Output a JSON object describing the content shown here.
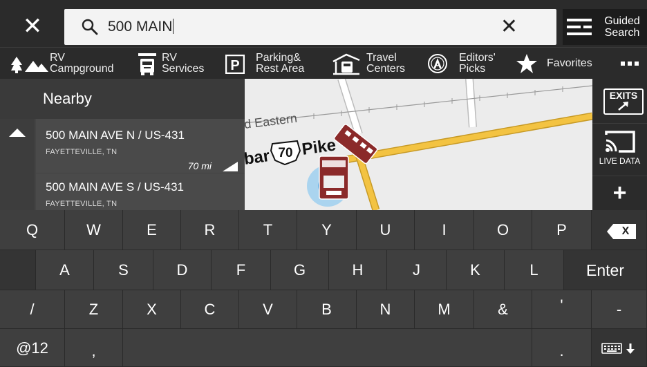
{
  "search": {
    "query": "500 MAIN",
    "guided_label": "Guided Search"
  },
  "categories": [
    {
      "label": "RV Campground",
      "icon": "trees-tent-icon"
    },
    {
      "label": "RV Services",
      "icon": "tools-rv-icon"
    },
    {
      "label": "Parking& Rest Area",
      "icon": "parking-icon"
    },
    {
      "label": "Travel Centers",
      "icon": "travel-center-icon"
    },
    {
      "label": "Editors' Picks",
      "icon": "editors-picks-icon"
    },
    {
      "label": "Favorites",
      "icon": "star-icon"
    },
    {
      "label": "...",
      "icon": "more-icon"
    }
  ],
  "panel": {
    "title": "Nearby",
    "results": [
      {
        "name": "500 MAIN AVE N / US-431",
        "city": "FAYETTEVILLE, TN",
        "distance": "70 mi"
      },
      {
        "name": "500 MAIN AVE S / US-431",
        "city": "FAYETTEVILLE, TN",
        "distance": ""
      }
    ]
  },
  "map": {
    "road_label_1": "d Eastern",
    "road_label_2": "bar",
    "route_number": "70",
    "road_label_3": "Pike"
  },
  "right": {
    "exits": "EXITS",
    "live_data": "LIVE DATA",
    "plus": "+"
  },
  "keyboard": {
    "row1": [
      "Q",
      "W",
      "E",
      "R",
      "T",
      "Y",
      "U",
      "I",
      "O",
      "P"
    ],
    "row2": [
      "A",
      "S",
      "D",
      "F",
      "G",
      "H",
      "J",
      "K",
      "L"
    ],
    "row3": [
      "/",
      "Z",
      "X",
      "C",
      "V",
      "B",
      "N",
      "M",
      "&",
      "'",
      "-"
    ],
    "enter": "Enter",
    "numbers": "@12",
    "comma": ",",
    "period": ".",
    "backspace": "X"
  },
  "colors": {
    "bar_bg": "#2b2b2b",
    "road_yellow": "#f3c342",
    "rv_red": "#8b2a2a",
    "location_blue": "#9fd0f0"
  }
}
